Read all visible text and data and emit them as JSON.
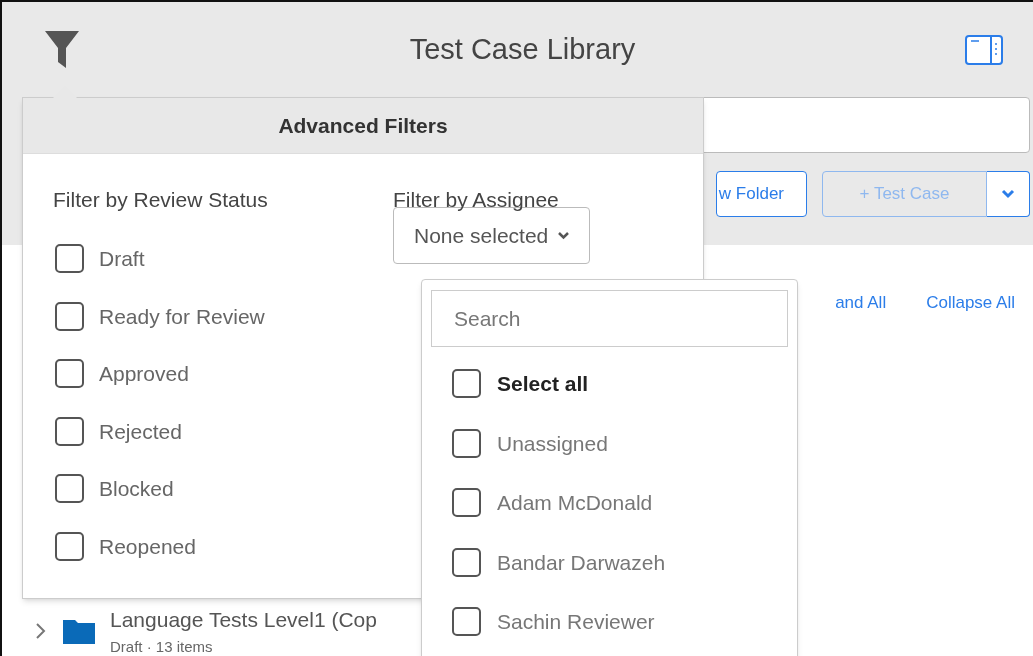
{
  "header": {
    "title": "Test Case Library"
  },
  "toolbar": {
    "folder_button": "w Folder",
    "test_case_button": "+ Test Case"
  },
  "links": [
    "and All",
    "Collapse All"
  ],
  "tree": [
    {
      "name": "Language Tests Level1 (Cop",
      "meta": "Draft · 13 items"
    }
  ],
  "advanced_filters": {
    "title": "Advanced Filters",
    "review_status": {
      "heading": "Filter by Review Status",
      "options": [
        {
          "label": "Draft",
          "checked": false
        },
        {
          "label": "Ready for Review",
          "checked": false
        },
        {
          "label": "Approved",
          "checked": false
        },
        {
          "label": "Rejected",
          "checked": false
        },
        {
          "label": "Blocked",
          "checked": false
        },
        {
          "label": "Reopened",
          "checked": false
        }
      ]
    },
    "assignee": {
      "heading": "Filter by Assignee",
      "select": "None selected",
      "expanded": true,
      "dropdown": {
        "search_placeholder": "Search",
        "options": [
          {
            "label": "Select all",
            "checked": false,
            "kind": "all"
          },
          {
            "label": "Unassigned",
            "checked": false,
            "kind": "option"
          },
          {
            "label": "Adam McDonald",
            "checked": false,
            "kind": "option"
          },
          {
            "label": "Bandar Darwazeh",
            "checked": false,
            "kind": "option"
          },
          {
            "label": "Sachin Reviewer",
            "checked": false,
            "kind": "option"
          }
        ]
      }
    }
  }
}
